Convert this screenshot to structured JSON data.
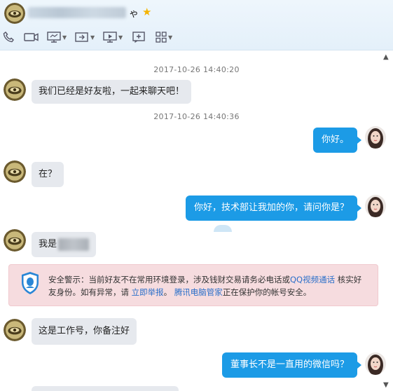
{
  "header": {
    "contact_suffix": "ゃ",
    "star_icon": "star-icon",
    "toolbar": [
      {
        "name": "voice-call-button",
        "icon": "phone-icon"
      },
      {
        "name": "video-call-button",
        "icon": "camera-icon"
      },
      {
        "name": "screen-share-button",
        "icon": "monitor-icon"
      },
      {
        "name": "file-transfer-button",
        "icon": "file-icon"
      },
      {
        "name": "remote-desktop-button",
        "icon": "remote-icon"
      },
      {
        "name": "add-contact-button",
        "icon": "add-icon"
      },
      {
        "name": "apps-button",
        "icon": "grid-icon"
      }
    ]
  },
  "messages": {
    "ts1": "2017-10-26 14:40:20",
    "m1": "我们已经是好友啦，一起来聊天吧！",
    "ts2": "2017-10-26 14:40:36",
    "m2": "你好。",
    "m3": "在？",
    "m4": "你好，技术部让我加的你，请问你是？",
    "m5_prefix": "我是",
    "m6": "这是工作号，你备注好",
    "m7": "董事长不是一直用的微信吗？"
  },
  "security": {
    "text_a": "安全警示：当前好友不在常用环境登录，涉及钱财交易请务必电话或",
    "link_video": "QQ视频通话",
    "text_b": "核实好友身份。如有异常，请",
    "link_report": "立即举报",
    "text_c": "。",
    "link_manager": "腾讯电脑管家",
    "text_d": "正在保护你的帐号安全。"
  },
  "colors": {
    "bubble_self": "#1c9be6",
    "bubble_other": "#e6e9ee",
    "warning_bg": "#f6dcdf",
    "link": "#2a6fc9"
  }
}
